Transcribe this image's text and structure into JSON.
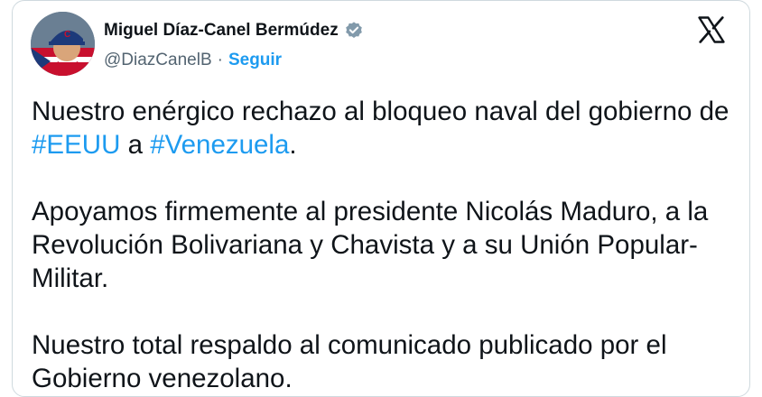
{
  "author": {
    "display_name": "Miguel Díaz-Canel Bermúdez",
    "handle": "@DiazCanelB",
    "separator": "·",
    "follow_label": "Seguir",
    "avatar_colors": {
      "cap": "#1d3a7a",
      "flag_red": "#c8102e",
      "flag_blue": "#1d3a7a",
      "skin": "#d9a57a",
      "background": "#6a7f93"
    }
  },
  "colors": {
    "link": "#1d9bf0",
    "text": "#0f1419",
    "muted": "#536471",
    "verified_badge": "#829aab"
  },
  "tweet": {
    "p1_a": "Nuestro enérgico rechazo al bloqueo naval del gobierno de ",
    "hashtag1": "#EEUU",
    "p1_b": " a ",
    "hashtag2": "#Venezuela",
    "p1_c": ".",
    "p2": "Apoyamos firmemente al presidente Nicolás Maduro, a la Revolución Bolivariana y Chavista y a su Unión Popular-Militar.",
    "p3": "Nuestro total respaldo al comunicado publicado por el Gobierno venezolano."
  },
  "icons": {
    "verified": "verified-badge-icon",
    "platform": "x-logo-icon"
  }
}
